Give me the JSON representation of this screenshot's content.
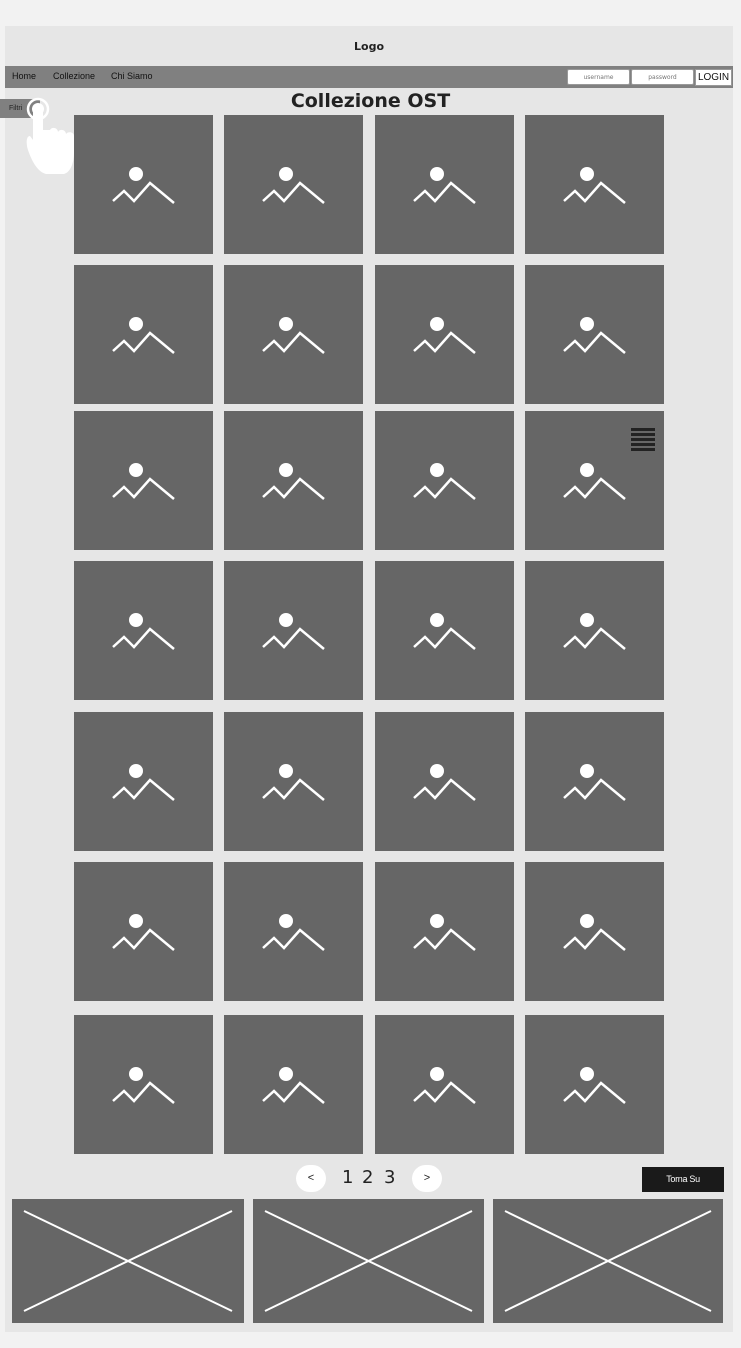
{
  "header": {
    "logo": "Logo"
  },
  "nav": {
    "items": [
      "Home",
      "Collezione",
      "Chi Siamo"
    ]
  },
  "login": {
    "username_placeholder": "username",
    "password_placeholder": "password",
    "button": "LOGIN"
  },
  "sidebar": {
    "filter_label": "Filtri"
  },
  "main": {
    "title": "Collezione OST",
    "grid": {
      "columns": 4,
      "rows": 7,
      "tile_icon": "image-placeholder-icon"
    }
  },
  "pagination": {
    "prev": "<",
    "next": ">",
    "pages": [
      "1",
      "2",
      "3"
    ]
  },
  "footer": {
    "back_to_top": "Torna Su",
    "placeholders": 3
  },
  "colors": {
    "frame": "#e6e6e6",
    "navbar": "#808080",
    "tile": "#666666",
    "button_dark": "#1a1a1a"
  }
}
